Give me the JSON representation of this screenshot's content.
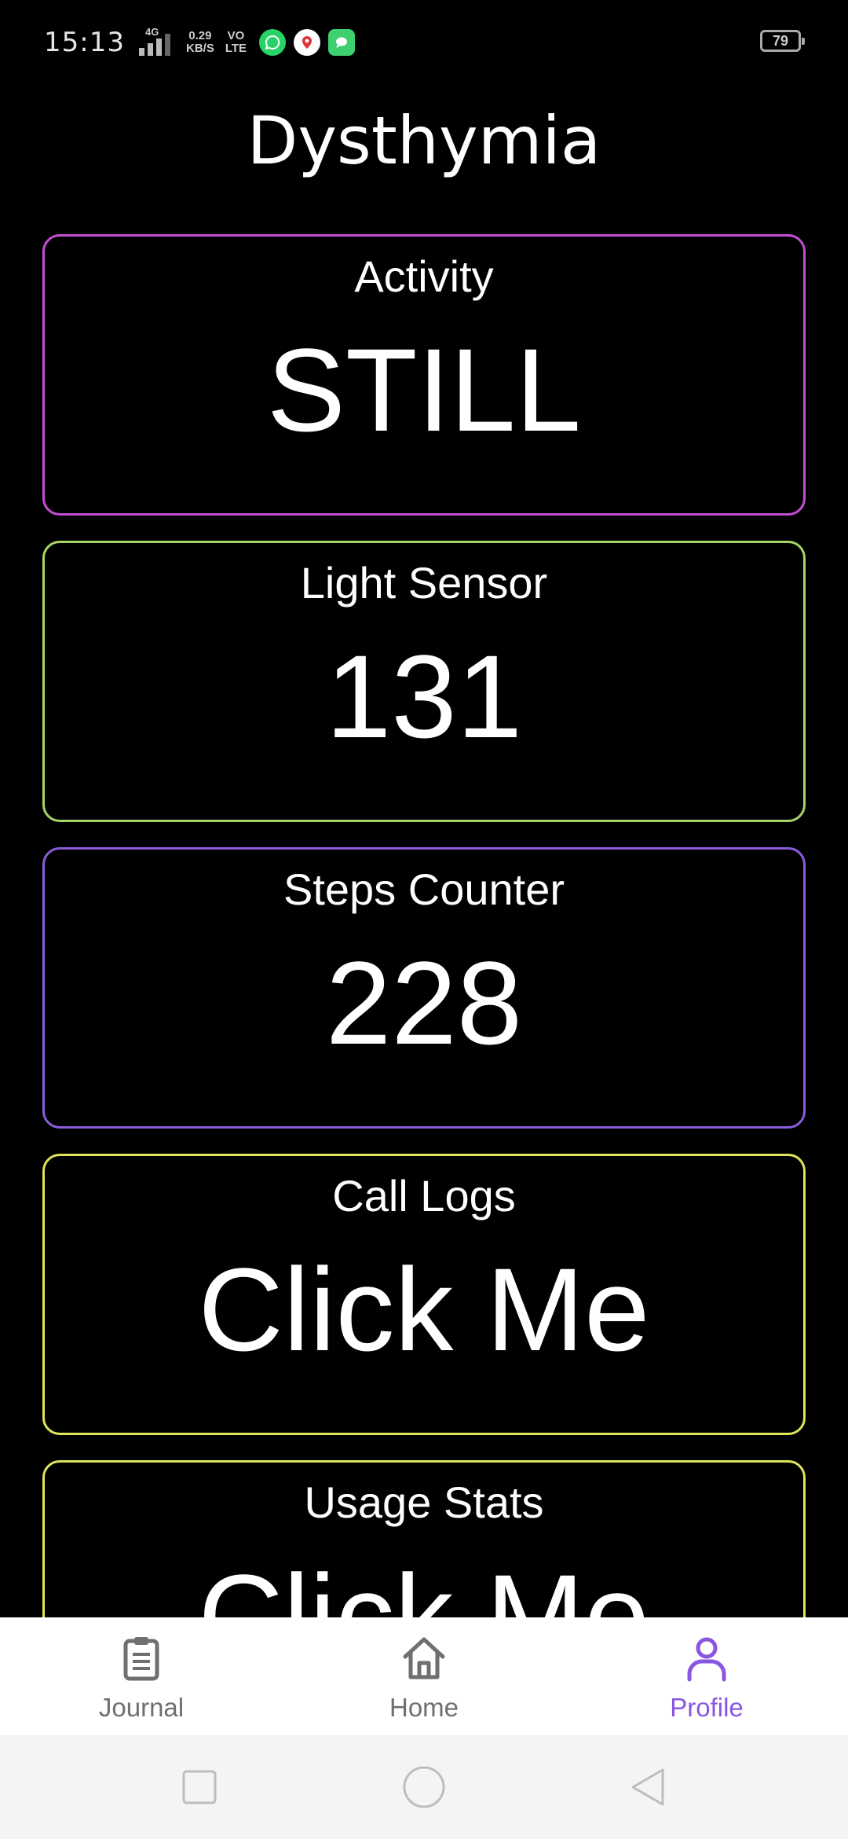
{
  "status_bar": {
    "time": "15:13",
    "network": "4G",
    "speed_value": "0.29",
    "speed_unit": "KB/S",
    "volte_top": "VO",
    "volte_bottom": "LTE",
    "battery": "79"
  },
  "app": {
    "title": "Dysthymia"
  },
  "cards": [
    {
      "label": "Activity",
      "value": "STILL",
      "border_color": "#c34ed1"
    },
    {
      "label": "Light Sensor",
      "value": "131",
      "border_color": "#a6d469"
    },
    {
      "label": "Steps Counter",
      "value": "228",
      "border_color": "#8a5cdb"
    },
    {
      "label": "Call Logs",
      "value": "Click Me",
      "border_color": "#dfe45a"
    },
    {
      "label": "Usage Stats",
      "value": "Click Me",
      "border_color": "#dfe45a"
    }
  ],
  "bottom_nav": {
    "items": [
      {
        "label": "Journal",
        "icon": "clipboard-icon",
        "active": false
      },
      {
        "label": "Home",
        "icon": "home-icon",
        "active": false
      },
      {
        "label": "Profile",
        "icon": "person-icon",
        "active": true
      }
    ],
    "active_color": "#8a55e0",
    "inactive_color": "#6f6f6f"
  },
  "system_nav": {
    "icons": [
      "recents-square-icon",
      "home-circle-icon",
      "back-triangle-icon"
    ]
  }
}
